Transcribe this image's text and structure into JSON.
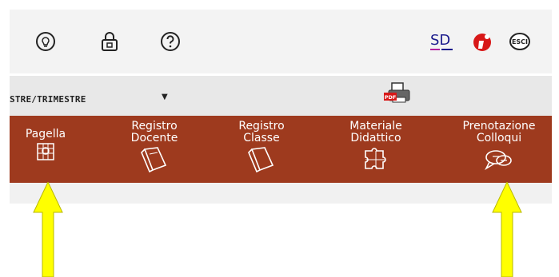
{
  "toolbar": {
    "icons": [
      "lightbulb-icon",
      "lock-icon",
      "help-icon"
    ],
    "right_icons": [
      "sd-logo-icon",
      "info-badge-icon",
      "exit-icon"
    ],
    "sd_logo_text": "SD",
    "exit_text": "ESCI"
  },
  "period_select": {
    "value": "STRE/TRIMESTRE",
    "arrow": "▼"
  },
  "print_icon": {
    "label": "PDF"
  },
  "nav": {
    "items": [
      {
        "line1": "Pagella",
        "line2": "",
        "icon": "report-card-icon"
      },
      {
        "line1": "Registro",
        "line2": "Docente",
        "icon": "book-icon"
      },
      {
        "line1": "Registro",
        "line2": "Classe",
        "icon": "book-icon"
      },
      {
        "line1": "Materiale",
        "line2": "Didattico",
        "icon": "puzzle-icon"
      },
      {
        "line1": "Prenotazione",
        "line2": "Colloqui",
        "icon": "chat-bubbles-icon"
      }
    ]
  },
  "colors": {
    "nav_bg": "#9e3a1e",
    "arrow": "#ffff00"
  }
}
